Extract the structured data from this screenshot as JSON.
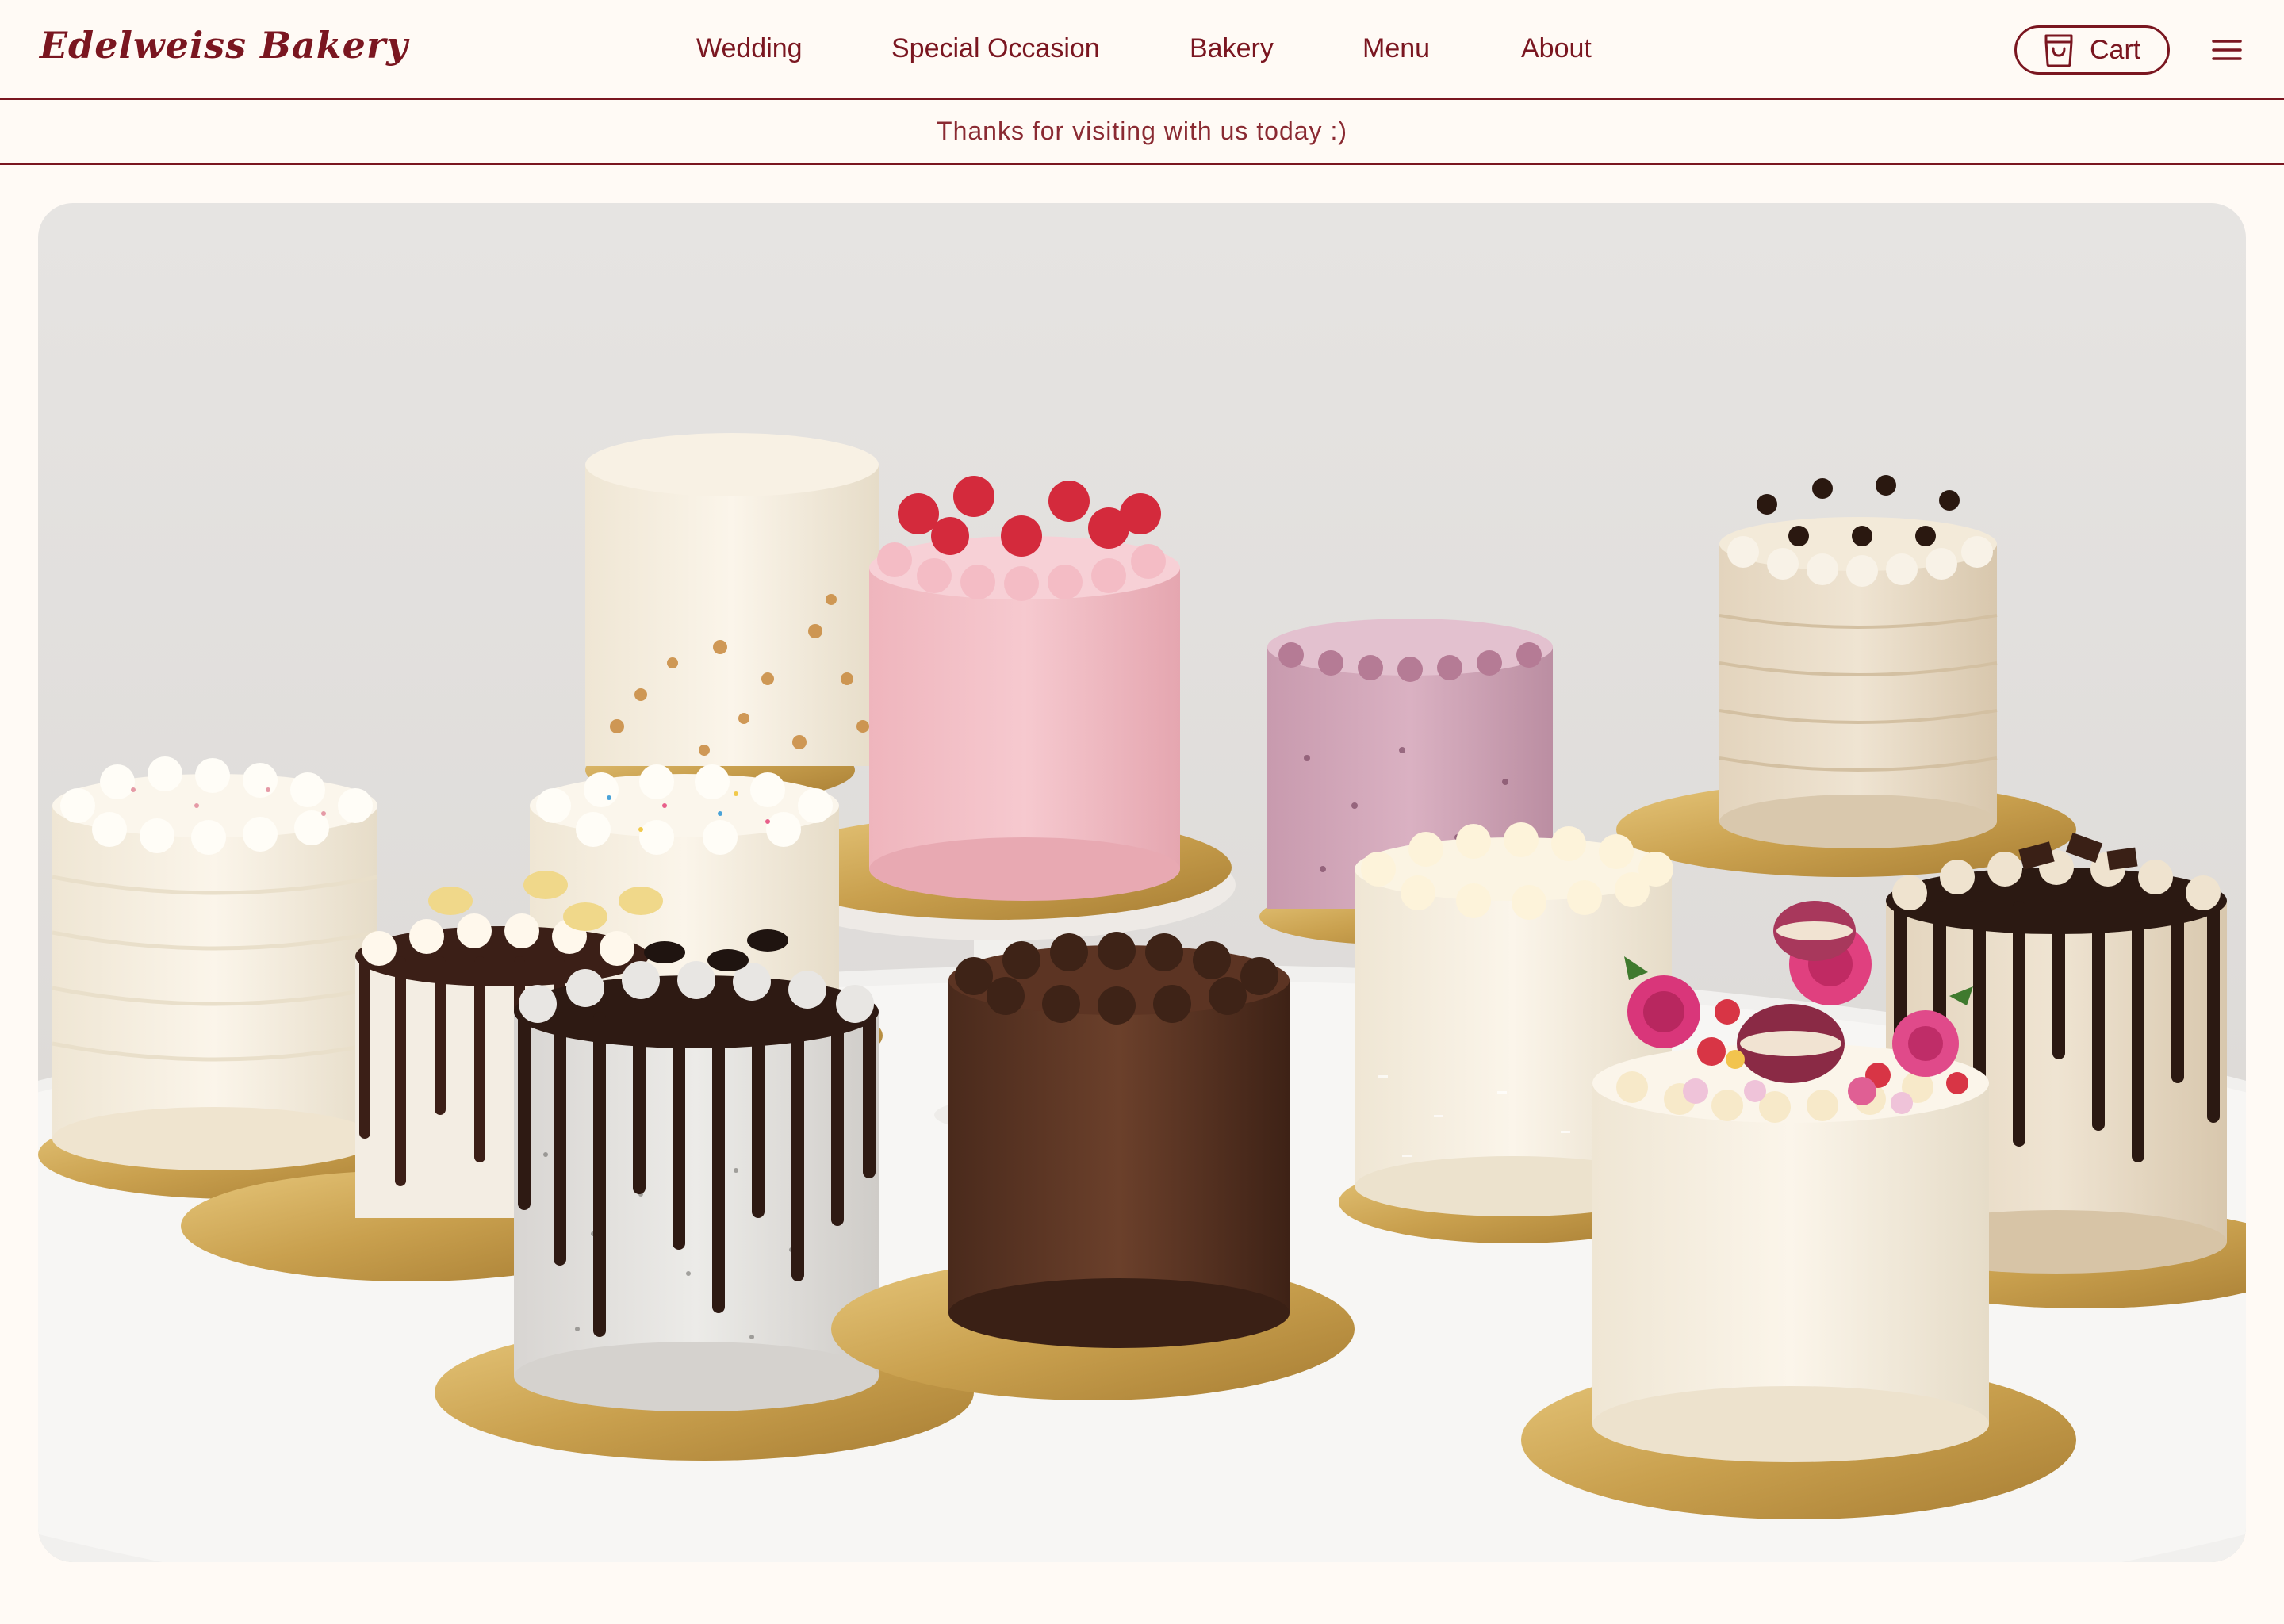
{
  "header": {
    "logo": "Edelweiss Bakery",
    "nav": [
      "Wedding",
      "Special Occasion",
      "Bakery",
      "Menu",
      "About"
    ],
    "cart_label": "Cart",
    "cart_icon": "shopping-bag-icon",
    "menu_icon": "hamburger-menu-icon"
  },
  "announcement": {
    "text": "Thanks for visiting with us today :)"
  },
  "hero": {
    "image": "photo of assorted layer cakes on gold boards on a white round table"
  },
  "colors": {
    "brand": "#7a1620",
    "background": "#fffaf5"
  }
}
